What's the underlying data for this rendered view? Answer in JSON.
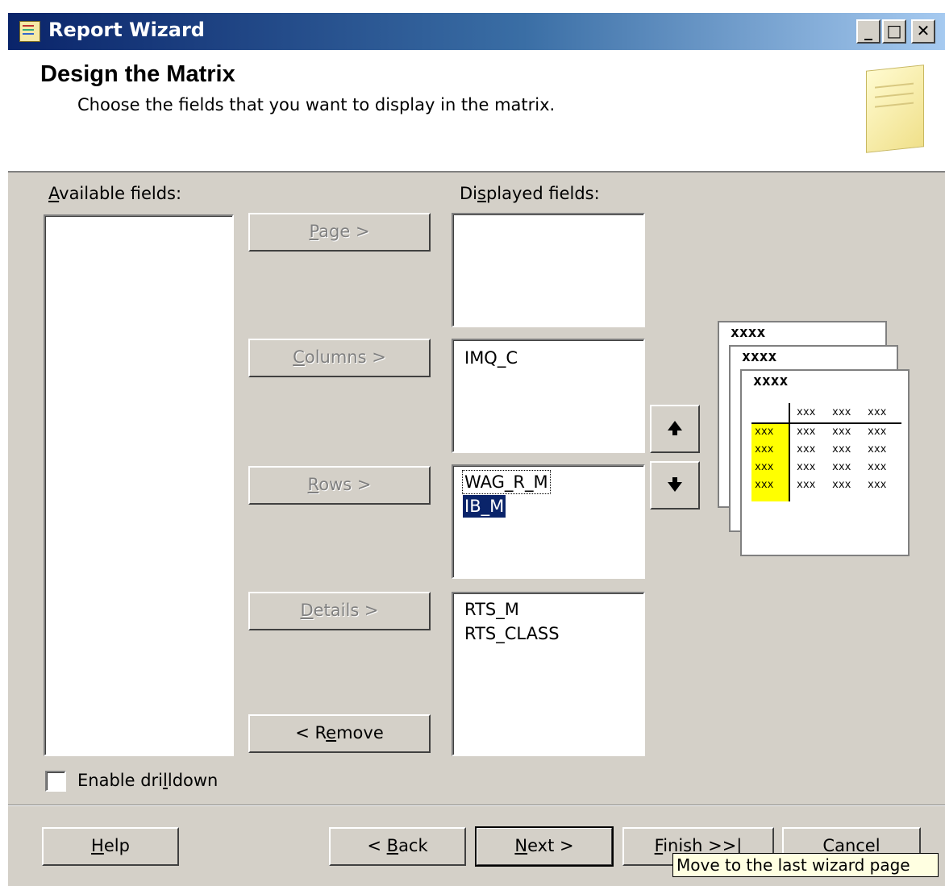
{
  "window": {
    "title": "Report Wizard",
    "minimize_label": "_",
    "maximize_label": "□",
    "close_label": "✕"
  },
  "header": {
    "title": "Design the Matrix",
    "subtitle": "Choose the fields that you want to display in the matrix."
  },
  "available": {
    "label_mnemonic": "A",
    "label_rest": "vailable fields:",
    "items": []
  },
  "displayed": {
    "label_pre": "Di",
    "label_mnemonic": "s",
    "label_rest": "played fields:",
    "page_items": [],
    "column_items": [
      "IMQ_C"
    ],
    "row_items": [
      {
        "text": "WAG_R_M",
        "selected": false,
        "focused": true
      },
      {
        "text": "IB_M",
        "selected": true,
        "focused": false
      }
    ],
    "detail_items": [
      "RTS_M",
      "RTS_CLASS"
    ]
  },
  "buttons": {
    "page": {
      "mn": "P",
      "rest": "age >"
    },
    "columns": {
      "mn": "C",
      "rest": "olumns >"
    },
    "rows": {
      "mn": "R",
      "rest": "ows >"
    },
    "details": {
      "mn": "D",
      "rest": "etails >"
    },
    "remove": {
      "pre": "< R",
      "mn": "e",
      "rest": "move"
    },
    "move_up_icon": "arrow-up-icon",
    "move_down_icon": "arrow-down-icon"
  },
  "preview": {
    "page_titles": [
      "xxxx",
      "xxxx",
      "xxxx"
    ],
    "header_cells": [
      "xxx",
      "xxx",
      "xxx"
    ],
    "rows": [
      [
        "xxx",
        "xxx",
        "xxx",
        "xxx"
      ],
      [
        "xxx",
        "xxx",
        "xxx",
        "xxx"
      ],
      [
        "xxx",
        "xxx",
        "xxx",
        "xxx"
      ],
      [
        "xxx",
        "xxx",
        "xxx",
        "xxx"
      ]
    ],
    "highlight_color": "#ffff00"
  },
  "drilldown": {
    "pre": "Enable dri",
    "mn": "l",
    "rest": "ldown",
    "checked": false
  },
  "footer": {
    "help": {
      "mn": "H",
      "rest": "elp"
    },
    "back": {
      "pre": "< ",
      "mn": "B",
      "rest": "ack"
    },
    "next": {
      "mn": "N",
      "rest": "ext >"
    },
    "finish": {
      "mn": "F",
      "rest": "inish >>|"
    },
    "cancel": "Cancel"
  },
  "tooltip": {
    "text": "Move to the last wizard page"
  }
}
